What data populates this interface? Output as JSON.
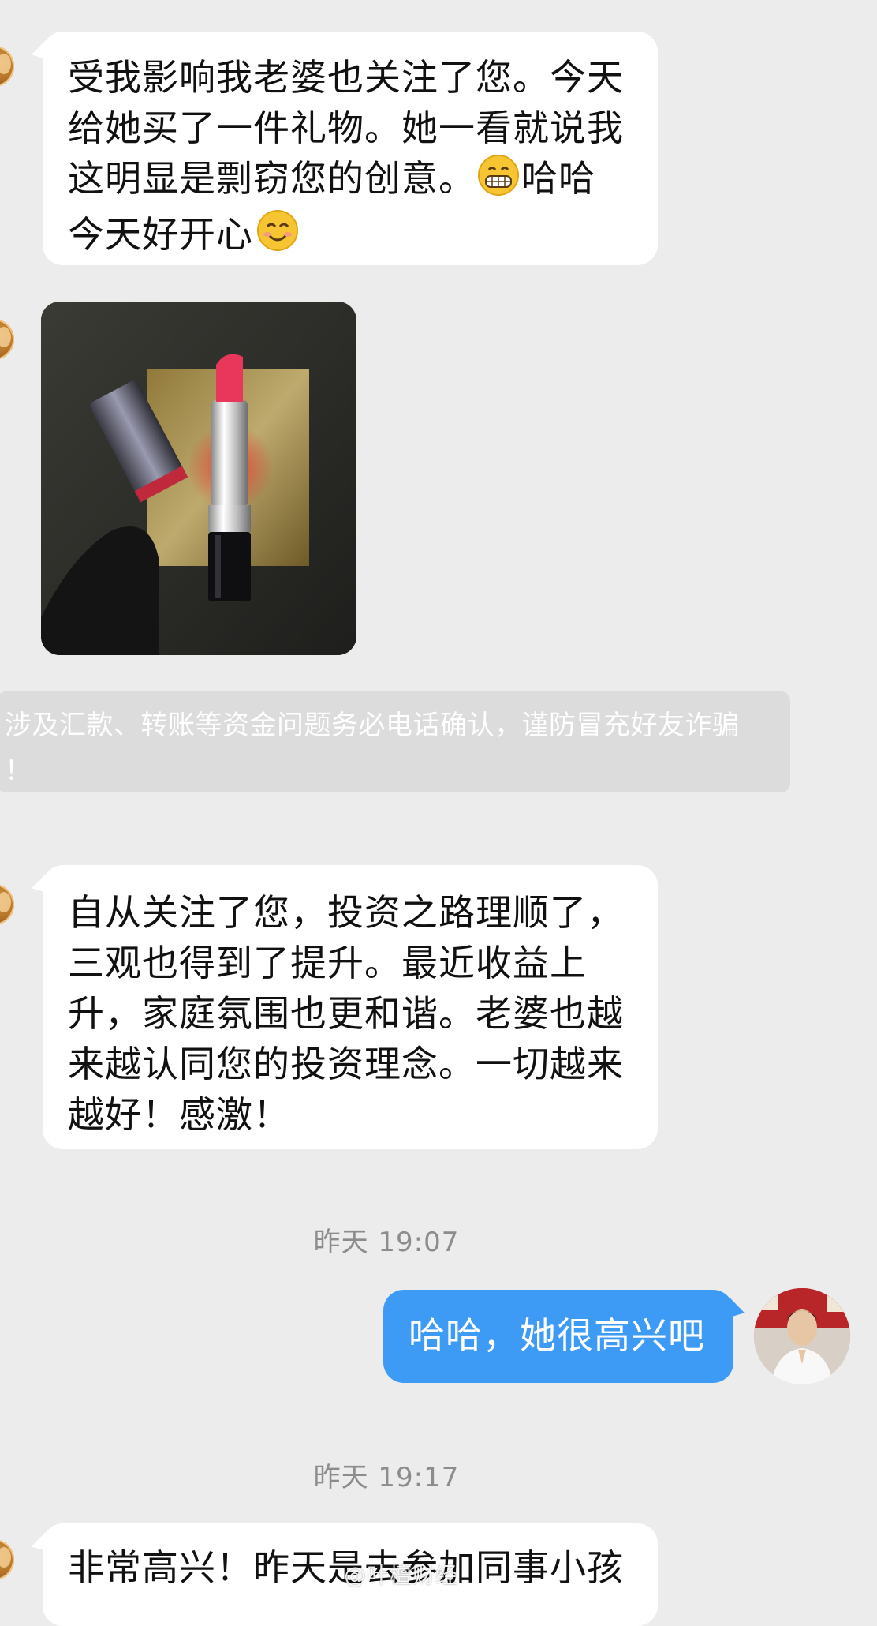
{
  "messages": {
    "m1": {
      "line1": "受我影响我老婆也关注了您。今天",
      "line2": "给她买了一件礼物。她一看就说我",
      "line3_pre": "这明显是剽窃您的创意。",
      "line3_post": "哈哈",
      "line4": "今天好开心"
    },
    "m3": {
      "line1": "自从关注了您，投资之路理顺了，",
      "line2": "三观也得到了提升。最近收益上",
      "line3": "升，家庭氛围也更和谐。老婆也越",
      "line4": "来越认同您的投资理念。一切越来",
      "line5": "越好！感激！"
    },
    "m4": "哈哈，她很高兴吧",
    "m5": "非常高兴！昨天是去参加同事小孩"
  },
  "system_notice": {
    "line1": "涉及汇款、转账等资金问题务必电话确认，谨防冒充好友诈骗",
    "line2": "！"
  },
  "timestamps": {
    "t1": "昨天 19:07",
    "t2": "昨天 19:17"
  },
  "watermark": "@叶檀财经",
  "icons": {
    "grin_emoji": "grinning-emoji-icon",
    "smile_emoji": "smiling-emoji-icon"
  }
}
